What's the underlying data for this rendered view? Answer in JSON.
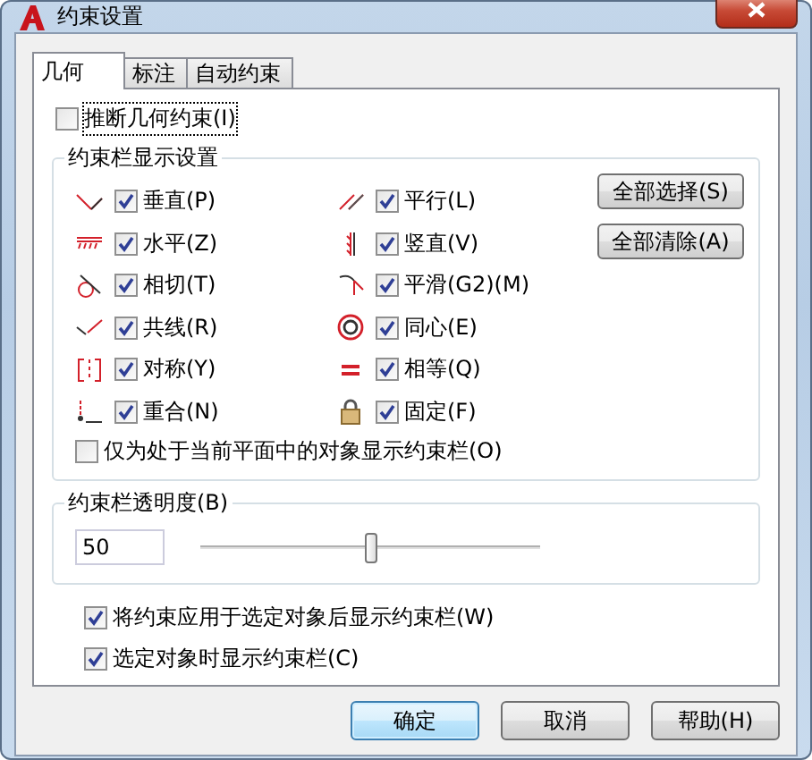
{
  "window": {
    "title": "约束设置"
  },
  "tabs": [
    {
      "label": "几何",
      "selected": true
    },
    {
      "label": "标注",
      "selected": false
    },
    {
      "label": "自动约束",
      "selected": false
    }
  ],
  "infer": {
    "label": "推断几何约束(I)",
    "checked": false
  },
  "display_group": {
    "title": "约束栏显示设置",
    "constraints": [
      {
        "label": "垂直(P)",
        "checked": true
      },
      {
        "label": "平行(L)",
        "checked": true
      },
      {
        "label": "水平(Z)",
        "checked": true
      },
      {
        "label": "竖直(V)",
        "checked": true
      },
      {
        "label": "相切(T)",
        "checked": true
      },
      {
        "label": "平滑(G2)(M)",
        "checked": true
      },
      {
        "label": "共线(R)",
        "checked": true
      },
      {
        "label": "同心(E)",
        "checked": true
      },
      {
        "label": "对称(Y)",
        "checked": true
      },
      {
        "label": "相等(Q)",
        "checked": true
      },
      {
        "label": "重合(N)",
        "checked": true
      },
      {
        "label": "固定(F)",
        "checked": true
      }
    ],
    "buttons": [
      "全部选择(S)",
      "全部清除(A)"
    ],
    "current_plane": {
      "label": "仅为处于当前平面中的对象显示约束栏(O)",
      "checked": false
    }
  },
  "transparency": {
    "title": "约束栏透明度(B)",
    "value": "50",
    "level": 0.5
  },
  "options": [
    {
      "label": "将约束应用于选定对象后显示约束栏(W)",
      "checked": true
    },
    {
      "label": "选定对象时显示约束栏(C)",
      "checked": true
    }
  ],
  "buttons": [
    {
      "label": "确定",
      "selected": true
    },
    {
      "label": "取消",
      "selected": false
    },
    {
      "label": "帮助(H)",
      "selected": false
    }
  ]
}
